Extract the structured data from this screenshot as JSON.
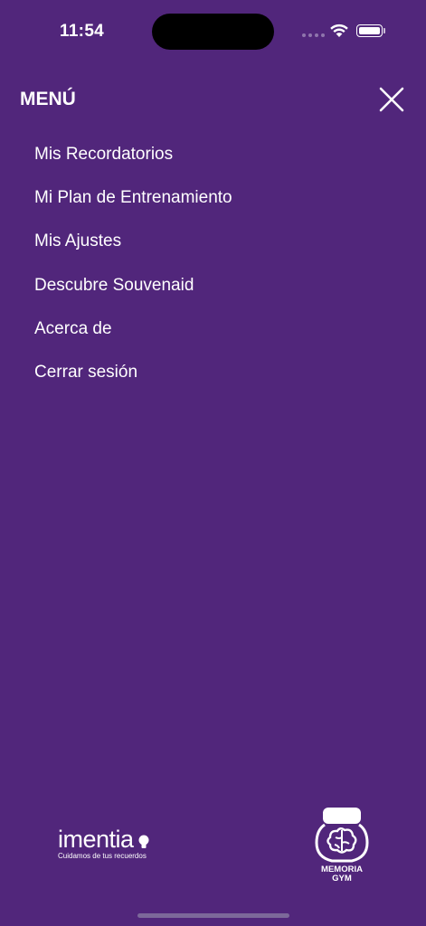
{
  "status_bar": {
    "time": "11:54",
    "icons": [
      "cellular-signal-icon",
      "wifi-icon",
      "battery-icon"
    ]
  },
  "header": {
    "title": "MENÚ",
    "close_icon": "close-icon"
  },
  "menu": {
    "items": [
      {
        "label": "Mis Recordatorios"
      },
      {
        "label": "Mi Plan de Entrenamiento"
      },
      {
        "label": "Mis Ajustes"
      },
      {
        "label": "Descubre Souvenaid"
      },
      {
        "label": "Acerca de"
      },
      {
        "label": "Cerrar sesión"
      }
    ]
  },
  "footer": {
    "imentia": {
      "name": "imentia",
      "tagline": "Cuidamos de tus recuerdos"
    },
    "memoria_gym": {
      "line1": "MEMORIA",
      "line2": "GYM"
    }
  },
  "colors": {
    "background": "#51267b",
    "text": "#ffffff"
  }
}
